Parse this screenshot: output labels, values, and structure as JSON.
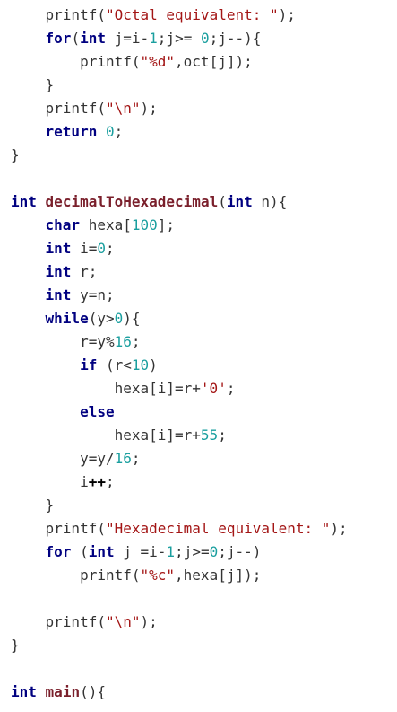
{
  "code_lines": [
    [
      {
        "t": "    ",
        "c": "plain"
      },
      {
        "t": "printf",
        "c": "plain"
      },
      {
        "t": "(",
        "c": "plain"
      },
      {
        "t": "\"Octal equivalent: \"",
        "c": "str"
      },
      {
        "t": ");",
        "c": "plain"
      }
    ],
    [
      {
        "t": "    ",
        "c": "plain"
      },
      {
        "t": "for",
        "c": "kw"
      },
      {
        "t": "(",
        "c": "plain"
      },
      {
        "t": "int",
        "c": "kw"
      },
      {
        "t": " j=i-",
        "c": "plain"
      },
      {
        "t": "1",
        "c": "num"
      },
      {
        "t": ";j>= ",
        "c": "plain"
      },
      {
        "t": "0",
        "c": "num"
      },
      {
        "t": ";j--){",
        "c": "plain"
      }
    ],
    [
      {
        "t": "        ",
        "c": "plain"
      },
      {
        "t": "printf",
        "c": "plain"
      },
      {
        "t": "(",
        "c": "plain"
      },
      {
        "t": "\"%d\"",
        "c": "str"
      },
      {
        "t": ",oct[j]);",
        "c": "plain"
      }
    ],
    [
      {
        "t": "    }",
        "c": "plain"
      }
    ],
    [
      {
        "t": "    ",
        "c": "plain"
      },
      {
        "t": "printf",
        "c": "plain"
      },
      {
        "t": "(",
        "c": "plain"
      },
      {
        "t": "\"\\n\"",
        "c": "str"
      },
      {
        "t": ");",
        "c": "plain"
      }
    ],
    [
      {
        "t": "    ",
        "c": "plain"
      },
      {
        "t": "return",
        "c": "kw"
      },
      {
        "t": " ",
        "c": "plain"
      },
      {
        "t": "0",
        "c": "num"
      },
      {
        "t": ";",
        "c": "plain"
      }
    ],
    [
      {
        "t": "}",
        "c": "plain"
      }
    ],
    [
      {
        "t": "",
        "c": "plain"
      }
    ],
    [
      {
        "t": "int",
        "c": "kw"
      },
      {
        "t": " ",
        "c": "plain"
      },
      {
        "t": "decimalToHexadecimal",
        "c": "fn"
      },
      {
        "t": "(",
        "c": "plain"
      },
      {
        "t": "int",
        "c": "kw"
      },
      {
        "t": " n){",
        "c": "plain"
      }
    ],
    [
      {
        "t": "    ",
        "c": "plain"
      },
      {
        "t": "char",
        "c": "kw"
      },
      {
        "t": " hexa[",
        "c": "plain"
      },
      {
        "t": "100",
        "c": "num"
      },
      {
        "t": "];",
        "c": "plain"
      }
    ],
    [
      {
        "t": "    ",
        "c": "plain"
      },
      {
        "t": "int",
        "c": "kw"
      },
      {
        "t": " i=",
        "c": "plain"
      },
      {
        "t": "0",
        "c": "num"
      },
      {
        "t": ";",
        "c": "plain"
      }
    ],
    [
      {
        "t": "    ",
        "c": "plain"
      },
      {
        "t": "int",
        "c": "kw"
      },
      {
        "t": " r;",
        "c": "plain"
      }
    ],
    [
      {
        "t": "    ",
        "c": "plain"
      },
      {
        "t": "int",
        "c": "kw"
      },
      {
        "t": " y=n;",
        "c": "plain"
      }
    ],
    [
      {
        "t": "    ",
        "c": "plain"
      },
      {
        "t": "while",
        "c": "kw"
      },
      {
        "t": "(y>",
        "c": "plain"
      },
      {
        "t": "0",
        "c": "num"
      },
      {
        "t": "){",
        "c": "plain"
      }
    ],
    [
      {
        "t": "        r=y%",
        "c": "plain"
      },
      {
        "t": "16",
        "c": "num"
      },
      {
        "t": ";",
        "c": "plain"
      }
    ],
    [
      {
        "t": "        ",
        "c": "plain"
      },
      {
        "t": "if",
        "c": "kw"
      },
      {
        "t": " (r<",
        "c": "plain"
      },
      {
        "t": "10",
        "c": "num"
      },
      {
        "t": ")",
        "c": "plain"
      }
    ],
    [
      {
        "t": "            hexa[i]=r+",
        "c": "plain"
      },
      {
        "t": "'0'",
        "c": "str"
      },
      {
        "t": ";",
        "c": "plain"
      }
    ],
    [
      {
        "t": "        ",
        "c": "plain"
      },
      {
        "t": "else",
        "c": "kw"
      }
    ],
    [
      {
        "t": "            hexa[i]=r+",
        "c": "plain"
      },
      {
        "t": "55",
        "c": "num"
      },
      {
        "t": ";",
        "c": "plain"
      }
    ],
    [
      {
        "t": "        y=y/",
        "c": "plain"
      },
      {
        "t": "16",
        "c": "num"
      },
      {
        "t": ";",
        "c": "plain"
      }
    ],
    [
      {
        "t": "        i",
        "c": "plain"
      },
      {
        "t": "++",
        "c": "op"
      },
      {
        "t": ";",
        "c": "plain"
      }
    ],
    [
      {
        "t": "    }",
        "c": "plain"
      }
    ],
    [
      {
        "t": "    ",
        "c": "plain"
      },
      {
        "t": "printf",
        "c": "plain"
      },
      {
        "t": "(",
        "c": "plain"
      },
      {
        "t": "\"Hexadecimal equivalent: \"",
        "c": "str"
      },
      {
        "t": ");",
        "c": "plain"
      }
    ],
    [
      {
        "t": "    ",
        "c": "plain"
      },
      {
        "t": "for",
        "c": "kw"
      },
      {
        "t": " (",
        "c": "plain"
      },
      {
        "t": "int",
        "c": "kw"
      },
      {
        "t": " j =i-",
        "c": "plain"
      },
      {
        "t": "1",
        "c": "num"
      },
      {
        "t": ";j>=",
        "c": "plain"
      },
      {
        "t": "0",
        "c": "num"
      },
      {
        "t": ";j--)",
        "c": "plain"
      }
    ],
    [
      {
        "t": "        ",
        "c": "plain"
      },
      {
        "t": "printf",
        "c": "plain"
      },
      {
        "t": "(",
        "c": "plain"
      },
      {
        "t": "\"%c\"",
        "c": "str"
      },
      {
        "t": ",hexa[j]);",
        "c": "plain"
      }
    ],
    [
      {
        "t": "",
        "c": "plain"
      }
    ],
    [
      {
        "t": "    ",
        "c": "plain"
      },
      {
        "t": "printf",
        "c": "plain"
      },
      {
        "t": "(",
        "c": "plain"
      },
      {
        "t": "\"\\n\"",
        "c": "str"
      },
      {
        "t": ");",
        "c": "plain"
      }
    ],
    [
      {
        "t": "}",
        "c": "plain"
      }
    ],
    [
      {
        "t": "",
        "c": "plain"
      }
    ],
    [
      {
        "t": "int",
        "c": "kw"
      },
      {
        "t": " ",
        "c": "plain"
      },
      {
        "t": "main",
        "c": "fn"
      },
      {
        "t": "(){",
        "c": "plain"
      }
    ]
  ]
}
